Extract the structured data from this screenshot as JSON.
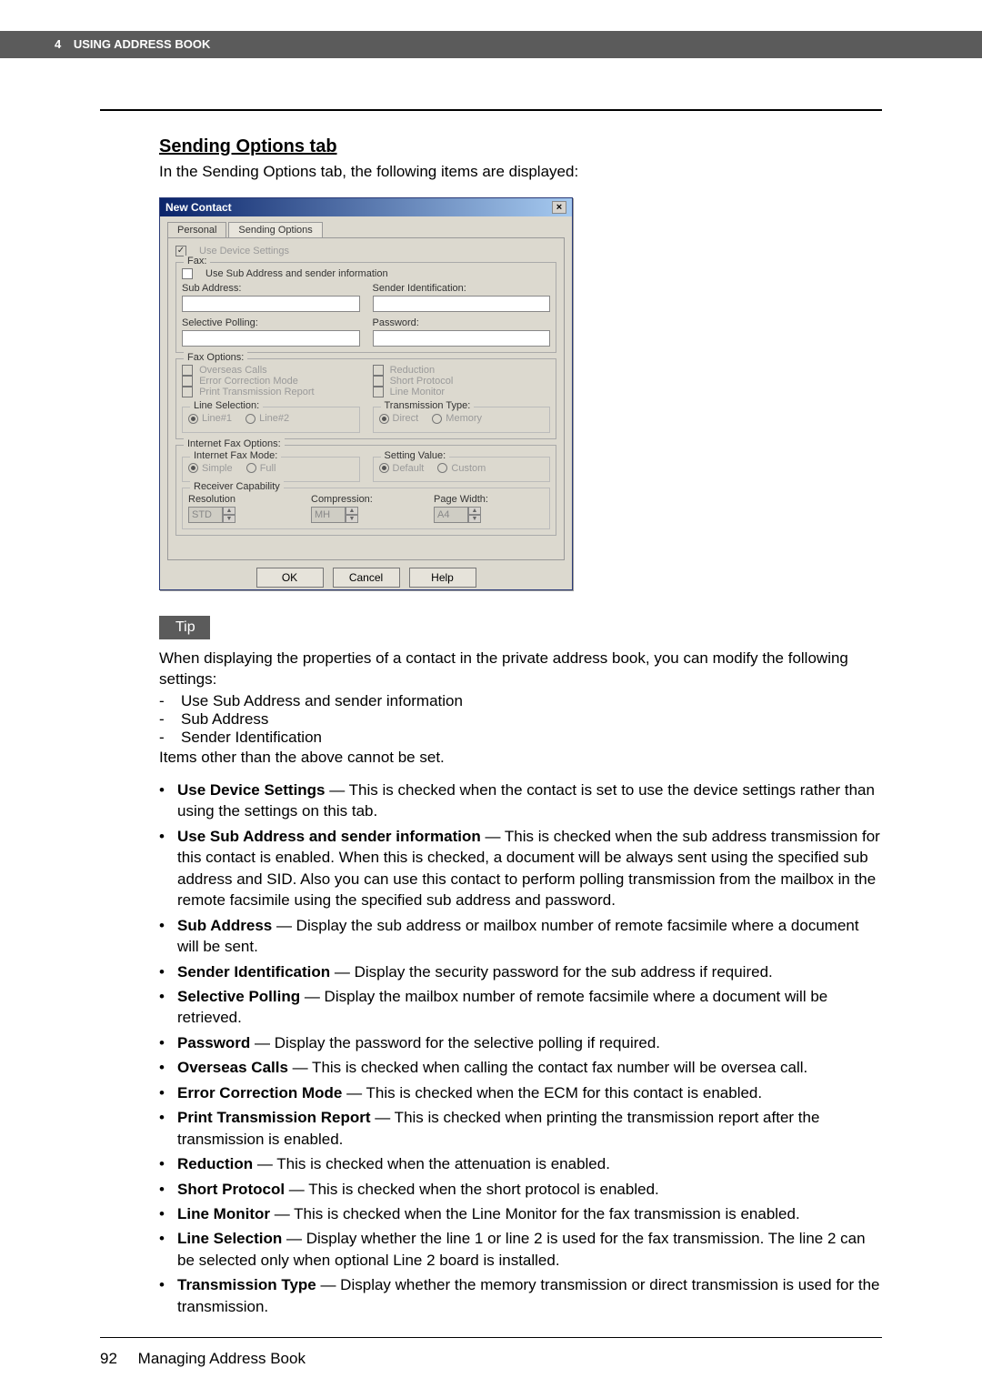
{
  "header": {
    "page": "4",
    "title": "USING ADDRESS BOOK"
  },
  "section": {
    "title": "Sending Options tab",
    "intro": "In the Sending Options tab, the following items are displayed:"
  },
  "dialog": {
    "title": "New Contact",
    "tabs": {
      "personal": "Personal",
      "sending": "Sending Options"
    },
    "use_device": "Use Device Settings",
    "fax": {
      "legend": "Fax:",
      "use_sub": "Use Sub Address and sender information",
      "sub_address": "Sub Address:",
      "sender_id": "Sender Identification:",
      "sel_polling": "Selective Polling:",
      "password": "Password:"
    },
    "fax_options": {
      "legend": "Fax Options:",
      "overseas": "Overseas Calls",
      "reduction": "Reduction",
      "ecm": "Error Correction Mode",
      "short": "Short Protocol",
      "print_report": "Print Transmission Report",
      "line_monitor": "Line Monitor",
      "line_sel": {
        "legend": "Line Selection:",
        "l1": "Line#1",
        "l2": "Line#2"
      },
      "trans": {
        "legend": "Transmission Type:",
        "direct": "Direct",
        "memory": "Memory"
      }
    },
    "ifax": {
      "legend": "Internet Fax Options:",
      "mode": {
        "legend": "Internet Fax Mode:",
        "simple": "Simple",
        "full": "Full"
      },
      "setting": {
        "legend": "Setting Value:",
        "default": "Default",
        "custom": "Custom"
      },
      "recv": {
        "legend": "Receiver Capability",
        "res": "Resolution",
        "res_v": "STD",
        "comp": "Compression:",
        "comp_v": "MH",
        "pw": "Page Width:",
        "pw_v": "A4"
      }
    },
    "buttons": {
      "ok": "OK",
      "cancel": "Cancel",
      "help": "Help"
    }
  },
  "tip": {
    "label": "Tip",
    "lead": "When displaying the properties of a contact in the private address book, you can modify the following settings:",
    "items": [
      "Use Sub Address and sender information",
      "Sub Address",
      "Sender Identification"
    ],
    "after": "Items other than the above cannot be set."
  },
  "bullets": [
    {
      "b": "Use Device Settings",
      "t": " — This is checked when the contact is set to use the device settings rather than using the settings on this tab."
    },
    {
      "b": "Use Sub Address and sender information",
      "t": " — This is checked when the sub address transmission for this contact is enabled. When this is checked, a document will be always sent using the specified sub address and SID. Also you can use this contact to perform polling transmission from the mailbox in the remote facsimile using the specified sub address and password."
    },
    {
      "b": "Sub Address",
      "t": " — Display the sub address or mailbox number of remote facsimile where a document will be sent."
    },
    {
      "b": "Sender Identification",
      "t": " — Display the security password for the sub address if required."
    },
    {
      "b": "Selective Polling",
      "t": " — Display the mailbox number of remote facsimile where a document will be retrieved."
    },
    {
      "b": "Password",
      "t": " — Display the password for the selective polling if required."
    },
    {
      "b": "Overseas Calls",
      "t": " — This is checked when calling the contact fax number will be oversea call."
    },
    {
      "b": "Error Correction Mode",
      "t": " — This is checked when the ECM for this contact is enabled."
    },
    {
      "b": "Print Transmission Report",
      "t": " — This is checked when printing the transmission report after the transmission is enabled."
    },
    {
      "b": "Reduction",
      "t": " — This is checked when the attenuation is enabled."
    },
    {
      "b": "Short Protocol",
      "t": " — This is checked when the short protocol is enabled."
    },
    {
      "b": "Line Monitor",
      "t": " — This is checked when the Line Monitor for the fax transmission is enabled."
    },
    {
      "b": "Line Selection",
      "t": " — Display whether the line 1 or line 2 is used for the fax transmission. The line 2 can be selected only when optional Line 2 board is installed."
    },
    {
      "b": "Transmission Type",
      "t": " — Display whether the memory transmission or direct transmission is used for the transmission."
    }
  ],
  "footer": {
    "page": "92",
    "title": "Managing Address Book"
  }
}
